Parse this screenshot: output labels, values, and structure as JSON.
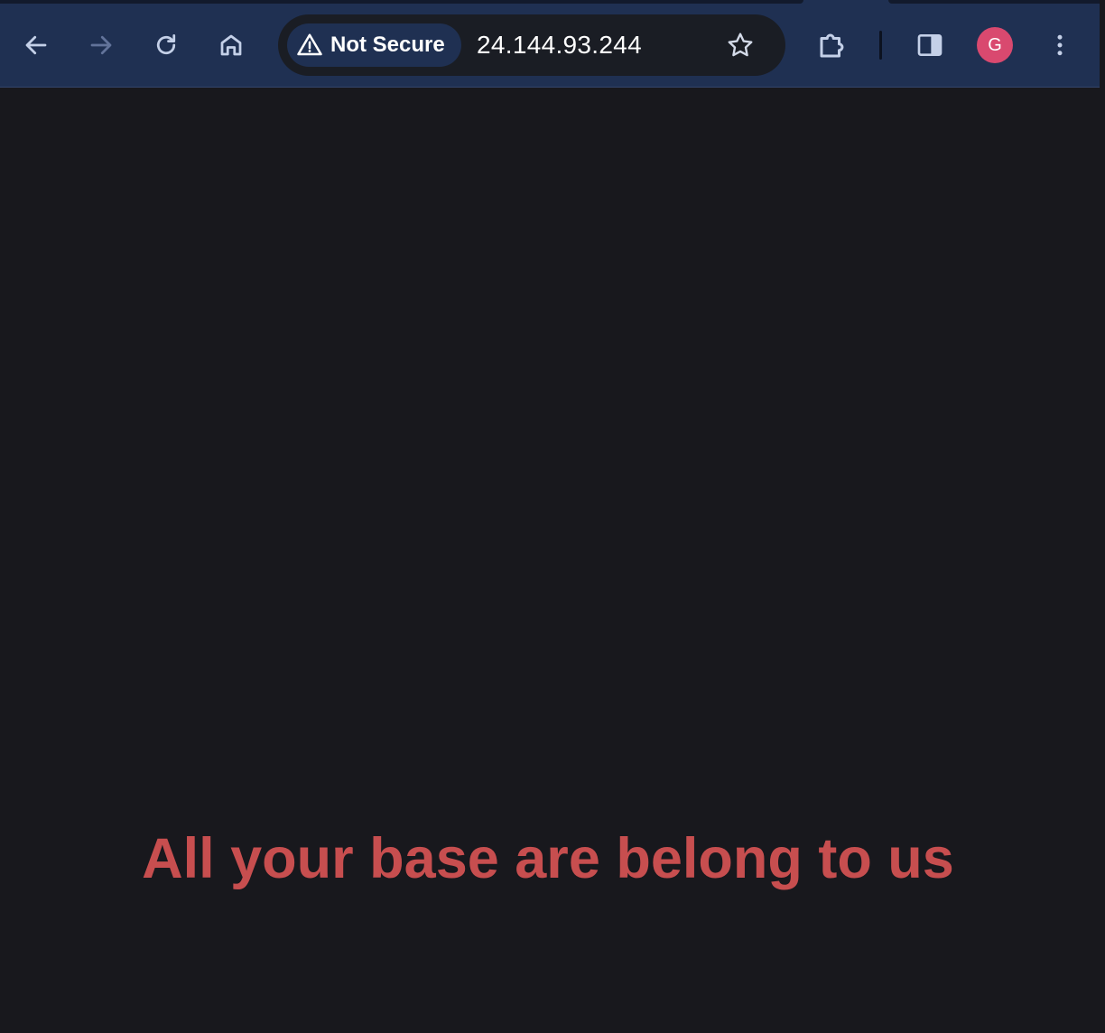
{
  "browser": {
    "security_label": "Not Secure",
    "url": "24.144.93.244",
    "profile_initial": "G",
    "icons": {
      "back": "back-arrow-icon",
      "forward": "forward-arrow-icon",
      "reload": "reload-icon",
      "home": "home-icon",
      "warning": "warning-triangle-icon",
      "bookmark": "star-icon",
      "extensions": "puzzle-piece-icon",
      "side_panel": "side-panel-icon",
      "menu": "kebab-menu-icon"
    },
    "colors": {
      "toolbar": "#1f3052",
      "omnibox": "#1a1d24",
      "avatar": "#d9496f"
    }
  },
  "page": {
    "headline": "All your base are belong to us",
    "colors": {
      "background": "#18181d",
      "headline": "#c74e4f"
    }
  }
}
